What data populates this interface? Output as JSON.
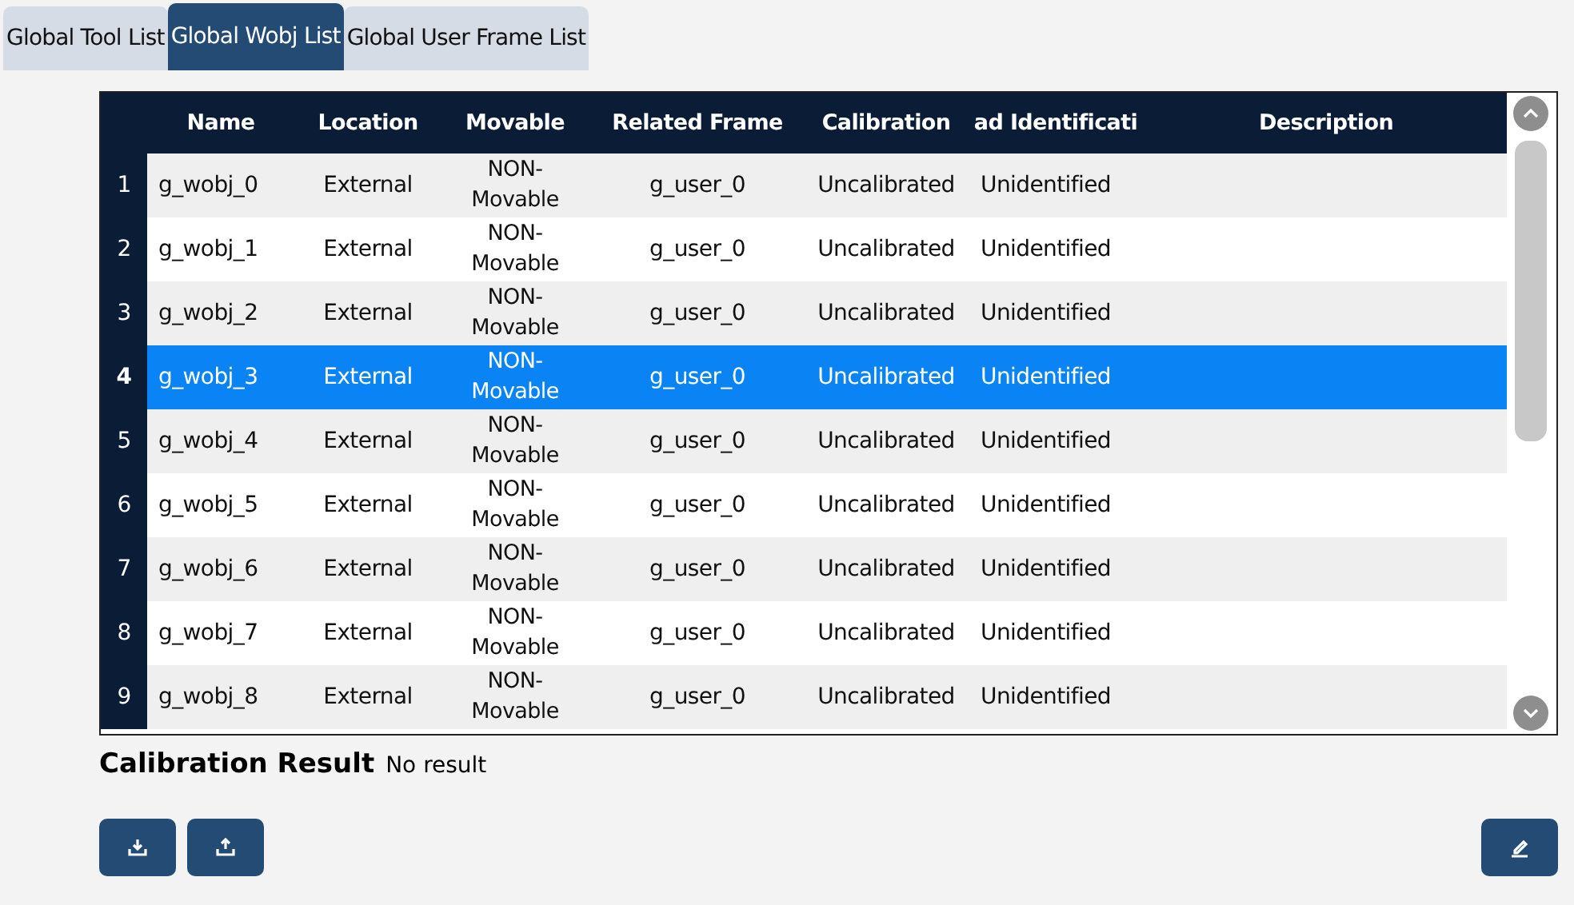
{
  "tabs": [
    {
      "label": "Global Tool List",
      "selected": false
    },
    {
      "label": "Global Wobj List",
      "selected": true
    },
    {
      "label": "Global User Frame List",
      "selected": false
    }
  ],
  "table": {
    "columns": [
      "Name",
      "Location",
      "Movable",
      "Related Frame",
      "Calibration",
      "ad Identificati",
      "Description"
    ],
    "rows": [
      {
        "index": "1",
        "cells": [
          "g_wobj_0",
          "External",
          "NON-Movable",
          "g_user_0",
          "Uncalibrated",
          "Unidentified",
          ""
        ],
        "selected": false
      },
      {
        "index": "2",
        "cells": [
          "g_wobj_1",
          "External",
          "NON-Movable",
          "g_user_0",
          "Uncalibrated",
          "Unidentified",
          ""
        ],
        "selected": false
      },
      {
        "index": "3",
        "cells": [
          "g_wobj_2",
          "External",
          "NON-Movable",
          "g_user_0",
          "Uncalibrated",
          "Unidentified",
          ""
        ],
        "selected": false
      },
      {
        "index": "4",
        "cells": [
          "g_wobj_3",
          "External",
          "NON-Movable",
          "g_user_0",
          "Uncalibrated",
          "Unidentified",
          ""
        ],
        "selected": true
      },
      {
        "index": "5",
        "cells": [
          "g_wobj_4",
          "External",
          "NON-Movable",
          "g_user_0",
          "Uncalibrated",
          "Unidentified",
          ""
        ],
        "selected": false
      },
      {
        "index": "6",
        "cells": [
          "g_wobj_5",
          "External",
          "NON-Movable",
          "g_user_0",
          "Uncalibrated",
          "Unidentified",
          ""
        ],
        "selected": false
      },
      {
        "index": "7",
        "cells": [
          "g_wobj_6",
          "External",
          "NON-Movable",
          "g_user_0",
          "Uncalibrated",
          "Unidentified",
          ""
        ],
        "selected": false
      },
      {
        "index": "8",
        "cells": [
          "g_wobj_7",
          "External",
          "NON-Movable",
          "g_user_0",
          "Uncalibrated",
          "Unidentified",
          ""
        ],
        "selected": false
      },
      {
        "index": "9",
        "cells": [
          "g_wobj_8",
          "External",
          "NON-Movable",
          "g_user_0",
          "Uncalibrated",
          "Unidentified",
          ""
        ],
        "selected": false
      }
    ]
  },
  "calibration_result": {
    "label": "Calibration Result",
    "value": "No result"
  }
}
